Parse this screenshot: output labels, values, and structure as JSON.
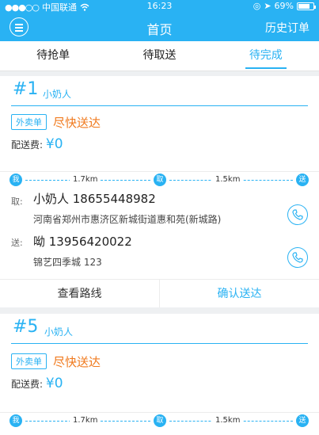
{
  "status_bar": {
    "carrier": "中国联通",
    "time": "16:23",
    "battery": "69%"
  },
  "nav": {
    "title": "首页",
    "right_button": "历史订单"
  },
  "tabs": [
    {
      "label": "待抢单"
    },
    {
      "label": "待取送"
    },
    {
      "label": "待完成"
    }
  ],
  "orders": [
    {
      "number": "#1",
      "customer": "小奶人",
      "tag": "外卖单",
      "urgency": "尽快送达",
      "fee_label": "配送费:",
      "fee": "¥0",
      "dot_start": "我",
      "dist1": "1.7km",
      "dot_pick": "取",
      "dist2": "1.5km",
      "dot_send": "送",
      "pickup_label": "取:",
      "pickup_contact": "小奶人  18655448982",
      "pickup_address": "河南省郑州市惠济区新城街道惠和苑(新城路)",
      "deliver_label": "送:",
      "deliver_contact": "呦  13956420022",
      "deliver_address": "锦艺四季城 123"
    },
    {
      "number": "#5",
      "customer": "小奶人",
      "tag": "外卖单",
      "urgency": "尽快送达",
      "fee_label": "配送费:",
      "fee": "¥0",
      "dot_start": "我",
      "dist1": "1.7km",
      "dot_pick": "取",
      "dist2": "1.5km",
      "dot_send": "送"
    }
  ],
  "actions": {
    "route": "查看路线",
    "confirm": "确认送达"
  },
  "colors": {
    "primary": "#29b2f3",
    "accent": "#f07a1e"
  }
}
